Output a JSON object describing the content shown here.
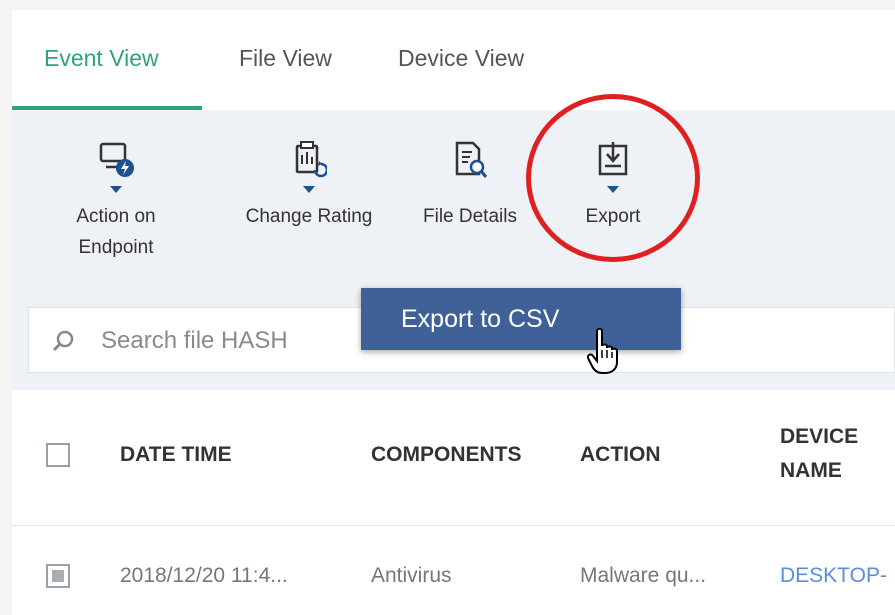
{
  "tabs": [
    {
      "label": "Event View",
      "active": true
    },
    {
      "label": "File View",
      "active": false
    },
    {
      "label": "Device View",
      "active": false
    }
  ],
  "toolbar": {
    "action_on_endpoint_line1": "Action on",
    "action_on_endpoint_line2": "Endpoint",
    "change_rating": "Change Rating",
    "file_details": "File Details",
    "export": "Export"
  },
  "export_menu": {
    "export_to_csv": "Export to CSV"
  },
  "search": {
    "placeholder": "Search file HASH"
  },
  "table": {
    "headers": {
      "date_time": "DATE TIME",
      "components": "COMPONENTS",
      "action": "ACTION",
      "device_name_line1": "DEVICE",
      "device_name_line2": "NAME"
    },
    "rows": [
      {
        "date_time": "2018/12/20 11:4...",
        "components": "Antivirus",
        "action": "Malware qu...",
        "device_name": "DESKTOP-"
      }
    ]
  },
  "colors": {
    "accent_green": "#2fa37a",
    "toolbar_bg": "#eef1f5",
    "menu_blue": "#3f6197",
    "highlight_red": "#e02020",
    "link_blue": "#5b8dd9"
  }
}
